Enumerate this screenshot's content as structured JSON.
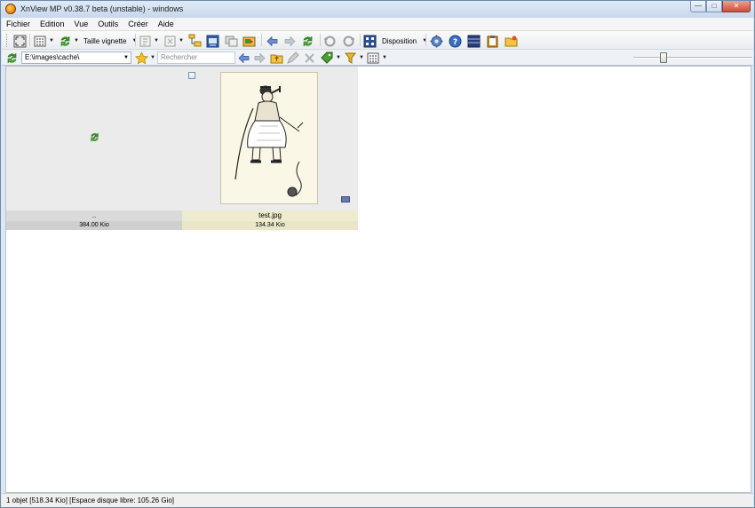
{
  "window": {
    "title": "XnView MP v0.38.7 beta (unstable) - windows"
  },
  "menu": [
    "Fichier",
    "Edition",
    "Vue",
    "Outils",
    "Créer",
    "Aide"
  ],
  "toolbar": {
    "thumbnail_size_label": "Taille vignette",
    "layout_label": "Disposition"
  },
  "addressbar": {
    "path": "E:\\images\\cache\\",
    "search_placeholder": "Rechercher"
  },
  "files": [
    {
      "name": "..",
      "size": "384.00 Kio"
    },
    {
      "name": "test.jpg",
      "size": "134.34 Kio"
    }
  ],
  "status": {
    "text": "1 objet [518.34 Kio] [Espace disque libre: 105.26 Gio]"
  },
  "colors": {
    "accent": "#2e5fa8",
    "window_frame": "#dce7f3",
    "selected_tile": "#eeebcf"
  }
}
